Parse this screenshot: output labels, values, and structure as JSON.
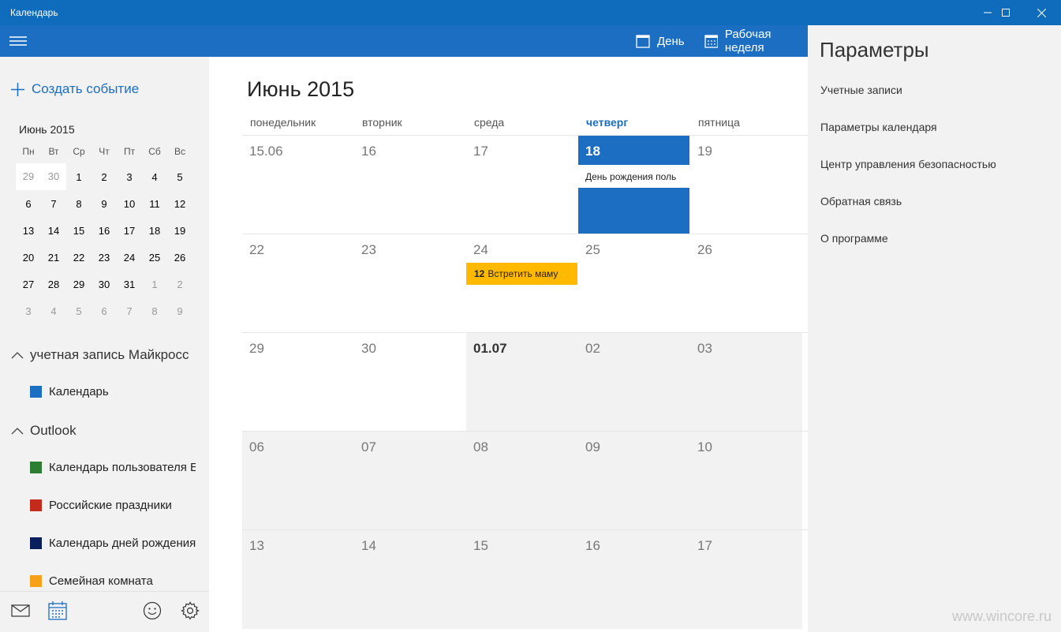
{
  "window": {
    "title": "Календарь",
    "controls": [
      "minimize-icon",
      "maximize-icon",
      "close-icon"
    ]
  },
  "toolbar": {
    "menu_icon": "hamburger-icon",
    "day_label": "День",
    "workweek_label": "Рабочая неделя"
  },
  "sidebar": {
    "create_event": "Создать событие",
    "mini_calendar": {
      "title": "Июнь 2015",
      "weekdays": [
        "Пн",
        "Вт",
        "Ср",
        "Чт",
        "Пт",
        "Сб",
        "Вс"
      ],
      "weeks": [
        [
          "29",
          "30",
          "1",
          "2",
          "3",
          "4",
          "5"
        ],
        [
          "6",
          "7",
          "8",
          "9",
          "10",
          "11",
          "12"
        ],
        [
          "13",
          "14",
          "15",
          "16",
          "17",
          "18",
          "19"
        ],
        [
          "20",
          "21",
          "22",
          "23",
          "24",
          "25",
          "26"
        ],
        [
          "27",
          "28",
          "29",
          "30",
          "31",
          "1",
          "2"
        ],
        [
          "3",
          "4",
          "5",
          "6",
          "7",
          "8",
          "9"
        ]
      ]
    },
    "accounts": [
      {
        "name": "учетная запись Майкросс",
        "calendars": [
          {
            "label": "Календарь",
            "color": "#1b6ec2"
          }
        ]
      },
      {
        "name": "Outlook",
        "calendars": [
          {
            "label": "Календарь пользователя Е",
            "color": "#2d7d32"
          },
          {
            "label": "Российские праздники",
            "color": "#c42b1c"
          },
          {
            "label": "Календарь дней рождения",
            "color": "#0b1f5c"
          },
          {
            "label": "Семейная комната",
            "color": "#f7a11a"
          }
        ]
      }
    ],
    "bottom_icons": [
      "mail-icon",
      "calendar-icon",
      "smiley-feedback-icon",
      "gear-icon"
    ]
  },
  "main": {
    "month_title": "Июнь 2015",
    "weekday_headers": [
      "понедельник",
      "вторник",
      "среда",
      "четверг",
      "пятница"
    ],
    "weeks": [
      [
        "15.06",
        "16",
        "17",
        "18",
        "19"
      ],
      [
        "22",
        "23",
        "24",
        "25",
        "26"
      ],
      [
        "29",
        "30",
        "01.07",
        "02",
        "03"
      ],
      [
        "06",
        "07",
        "08",
        "09",
        "10"
      ],
      [
        "13",
        "14",
        "15",
        "16",
        "17"
      ]
    ],
    "today_event": "День рождения поль",
    "event_time": "12",
    "event_title": "Встретить маму"
  },
  "settings": {
    "title": "Параметры",
    "items": [
      "Учетные записи",
      "Параметры календаря",
      "Центр управления безопасностью",
      "Обратная связь",
      "О программе"
    ]
  },
  "watermark": "www.wincore.ru"
}
